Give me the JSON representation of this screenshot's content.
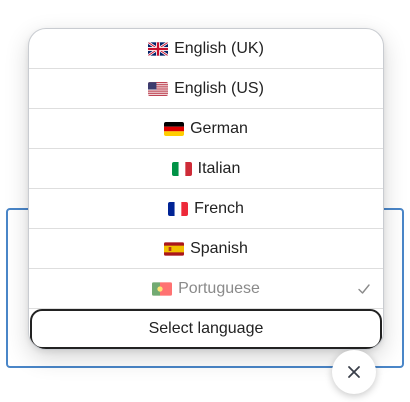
{
  "languages": [
    {
      "label": "English (UK)",
      "flag_icon": "uk-flag-icon"
    },
    {
      "label": "English (US)",
      "flag_icon": "us-flag-icon"
    },
    {
      "label": "German",
      "flag_icon": "germany-flag-icon"
    },
    {
      "label": "Italian",
      "flag_icon": "italy-flag-icon"
    },
    {
      "label": "French",
      "flag_icon": "france-flag-icon"
    },
    {
      "label": "Spanish",
      "flag_icon": "spain-flag-icon"
    },
    {
      "label": "Portuguese",
      "flag_icon": "portugal-flag-icon",
      "selected": true
    }
  ],
  "select_button_label": "Select language",
  "close_icon": "close-icon",
  "colors": {
    "panel_border": "#4a86c8",
    "selected_text": "#8a8a8a",
    "text": "#222222"
  }
}
